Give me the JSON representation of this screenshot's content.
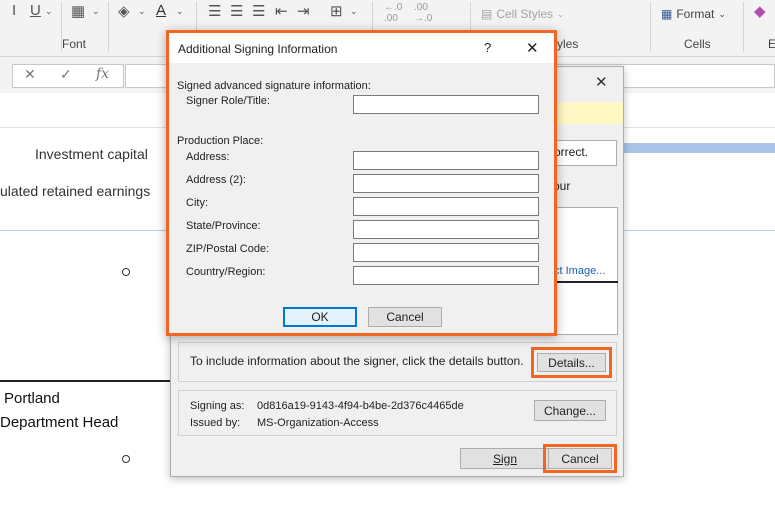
{
  "ribbon": {
    "groups": {
      "font": "Font",
      "cells": "Cells",
      "styles_partial": "yles"
    },
    "cell_styles": "Cell Styles",
    "format": "Format",
    "partial_e": "E"
  },
  "formula_bar": {
    "cancel": "✕",
    "enter": "✓",
    "fx": "fx"
  },
  "sheet": {
    "investment_capital": "Investment capital",
    "retained_earnings": "ulated retained earnings",
    "portland": "Portland",
    "department_head": "Department Head"
  },
  "signature_dialog": {
    "correct_partial": "orrect.",
    "your_partial": "our",
    "select_image_partial": "ct Image...",
    "details_prompt": "To include information about the signer, click the details button.",
    "details_button": "Details...",
    "signing_as_label": "Signing as:",
    "signing_as_value": "0d816a19-9143-4f94-b4be-2d376c4465de",
    "issued_by_label": "Issued by:",
    "issued_by_value": "MS-Organization-Access",
    "change_button": "Change...",
    "sign_button": "Sign",
    "cancel_button": "Cancel"
  },
  "additional_dialog": {
    "title": "Additional Signing Information",
    "help": "?",
    "close": "✕",
    "section_signed": "Signed advanced signature information:",
    "signer_role_label": "Signer Role/Title:",
    "section_production": "Production Place:",
    "fields": {
      "address": "Address:",
      "address2": "Address (2):",
      "city": "City:",
      "state": "State/Province:",
      "zip": "ZIP/Postal Code:",
      "country": "Country/Region:"
    },
    "ok_button": "OK",
    "cancel_button": "Cancel"
  },
  "colors": {
    "highlight": "#f26522",
    "accent_bar": "#a9c4e8"
  }
}
